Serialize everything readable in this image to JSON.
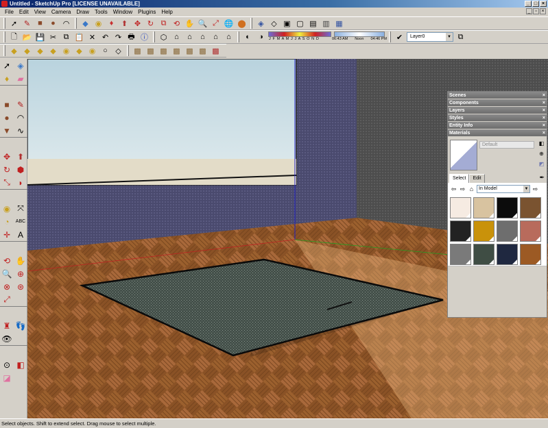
{
  "window": {
    "title": "Untitled - SketchUp Pro [LICENSE UNAVAILABLE]"
  },
  "menu": [
    "File",
    "Edit",
    "View",
    "Camera",
    "Draw",
    "Tools",
    "Window",
    "Plugins",
    "Help"
  ],
  "toolbar": {
    "shadow_months": "J F M A M J J A S O N D",
    "shadow_time_start": "06:43 AM",
    "shadow_time_mid": "Noon",
    "shadow_time_end": "04:46 PM",
    "layer_value": "Layer0"
  },
  "tray": {
    "panels": [
      "Scenes",
      "Components",
      "Layers",
      "Styles",
      "Entity Info",
      "Materials"
    ],
    "materials": {
      "name_value": "Default",
      "tabs": [
        "Select",
        "Edit"
      ],
      "collection": "In Model",
      "swatch_colors": [
        "#f6ebe2",
        "#d8c3a0",
        "#0c0c0c",
        "#7a5330",
        "#222222",
        "#c9920a",
        "#6e6e6e",
        "#b86b5c",
        "#7a7a7a",
        "#3f4d44",
        "#1f2840",
        "#9c5a24"
      ]
    }
  },
  "status": {
    "text": "Select objects. Shift to extend select. Drag mouse to select multiple."
  }
}
